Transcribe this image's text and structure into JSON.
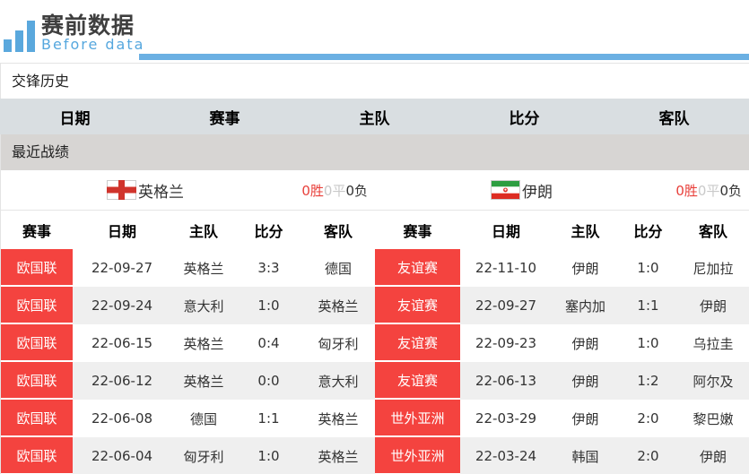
{
  "header": {
    "logo_title": "赛前数据",
    "logo_subtitle": "Before data"
  },
  "h2h": {
    "title": "交锋历史",
    "columns": [
      "日期",
      "赛事",
      "主队",
      "比分",
      "客队"
    ]
  },
  "recent": {
    "title": "最近战绩",
    "columns": [
      "赛事",
      "日期",
      "主队",
      "比分",
      "客队"
    ],
    "left": {
      "team": "英格兰",
      "flag": "england-flag",
      "record": {
        "wins": "0胜",
        "draws": "0平",
        "losses": "0负"
      },
      "rows": [
        {
          "competition": "欧国联",
          "date": "22-09-27",
          "home": "英格兰",
          "score": "3:3",
          "away": "德国"
        },
        {
          "competition": "欧国联",
          "date": "22-09-24",
          "home": "意大利",
          "score": "1:0",
          "away": "英格兰"
        },
        {
          "competition": "欧国联",
          "date": "22-06-15",
          "home": "英格兰",
          "score": "0:4",
          "away": "匈牙利"
        },
        {
          "competition": "欧国联",
          "date": "22-06-12",
          "home": "英格兰",
          "score": "0:0",
          "away": "意大利"
        },
        {
          "competition": "欧国联",
          "date": "22-06-08",
          "home": "德国",
          "score": "1:1",
          "away": "英格兰"
        },
        {
          "competition": "欧国联",
          "date": "22-06-04",
          "home": "匈牙利",
          "score": "1:0",
          "away": "英格兰"
        }
      ]
    },
    "right": {
      "team": "伊朗",
      "flag": "iran-flag",
      "record": {
        "wins": "0胜",
        "draws": "0平",
        "losses": "0负"
      },
      "rows": [
        {
          "competition": "友谊赛",
          "date": "22-11-10",
          "home": "伊朗",
          "score": "1:0",
          "away": "尼加拉"
        },
        {
          "competition": "友谊赛",
          "date": "22-09-27",
          "home": "塞内加",
          "score": "1:1",
          "away": "伊朗"
        },
        {
          "competition": "友谊赛",
          "date": "22-09-23",
          "home": "伊朗",
          "score": "1:0",
          "away": "乌拉圭"
        },
        {
          "competition": "友谊赛",
          "date": "22-06-13",
          "home": "伊朗",
          "score": "1:2",
          "away": "阿尔及"
        },
        {
          "competition": "世外亚洲",
          "date": "22-03-29",
          "home": "伊朗",
          "score": "2:0",
          "away": "黎巴嫩"
        },
        {
          "competition": "世外亚洲",
          "date": "22-03-24",
          "home": "韩国",
          "score": "2:0",
          "away": "伊朗"
        }
      ]
    }
  },
  "colors": {
    "accent_blue": "#6BB0E3",
    "logo_blue": "#5AA8DD",
    "badge_red": "#F4433F",
    "win_red": "#E8403B",
    "draw_gray": "#C9C9C9",
    "h2h_header_gray": "#D9DEE1",
    "recent_bar_gray": "#D7D5D3",
    "row_alt_gray": "#EFEFEF",
    "england_cross_red": "#D0342C",
    "iran_green": "#2D9E41",
    "iran_red": "#DD2C22"
  }
}
